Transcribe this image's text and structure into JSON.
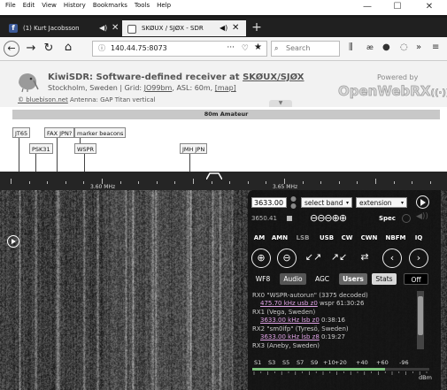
{
  "menu": [
    "File",
    "Edit",
    "View",
    "History",
    "Bookmarks",
    "Tools",
    "Help"
  ],
  "window_controls": {
    "minimize": "—",
    "maximize": "☐",
    "close": "✕"
  },
  "tabs": [
    {
      "label": "(1) Kurt Jacobsson",
      "icon_color": "#3b5998"
    },
    {
      "label": "SKØUX / SJØX - SDR",
      "icon_color": "#ffffff"
    }
  ],
  "nav": {
    "url": "140.44.75:8073",
    "search_placeholder": "Search"
  },
  "kiwi": {
    "title_prefix": "KiwiSDR: Software-defined receiver at ",
    "title_call": "SKØUX/SJØX",
    "sub_prefix": "Stockholm, Sweden | Grid: ",
    "grid": "JO99bm",
    "asl": ", ASL: 60m, ",
    "map": "[map]",
    "copyright": "© bluebison.net",
    "antenna": " Antenna: GAP Titan vertical",
    "powered": "Powered by",
    "openwebrx": "OpenWebRX"
  },
  "band": {
    "label": "80m Amateur"
  },
  "labels": [
    {
      "text": "JT65"
    },
    {
      "text": "FAX JPN?"
    },
    {
      "text": "marker beacons"
    },
    {
      "text": "PSK31"
    },
    {
      "text": "WSPR"
    },
    {
      "text": "JMH JPN"
    }
  ],
  "scale": {
    "left": "3.60 MHz",
    "right": "3.65 MHz"
  },
  "panel": {
    "freq": "3633.00",
    "band_select": "select band",
    "ext_select": "extension",
    "freq_small": "3650.41",
    "spec": "Spec",
    "modes": [
      "AM",
      "AMN",
      "LSB",
      "USB",
      "CW",
      "CWN",
      "NBFM",
      "IQ"
    ],
    "tabs": [
      "WF8",
      "Audio",
      "AGC",
      "Users",
      "Stats",
      "Off"
    ],
    "users": [
      {
        "id": "RX0",
        "text": " \"WSPR-autorun\" (3375 decoded)",
        "link": "475.70 kHz usb z0",
        "extra": " wspr 61:30:26"
      },
      {
        "id": "RX1",
        "text": " (Vega, Sweden)",
        "link": "3633.00 kHz lsb z0",
        "extra": " 0:38:16"
      },
      {
        "id": "RX2",
        "text": " \"sm0ifp\" (Tyresö, Sweden)",
        "link": "3633.00 kHz lsb z8",
        "extra": " 0:19:27"
      },
      {
        "id": "RX3",
        "text": " (Aneby, Sweden)",
        "link": "",
        "extra": ""
      }
    ],
    "smeter": [
      "S1",
      "S3",
      "S5",
      "S7",
      "S9",
      "+10",
      "+20",
      "+40",
      "+60",
      "-96",
      "dBm"
    ]
  }
}
